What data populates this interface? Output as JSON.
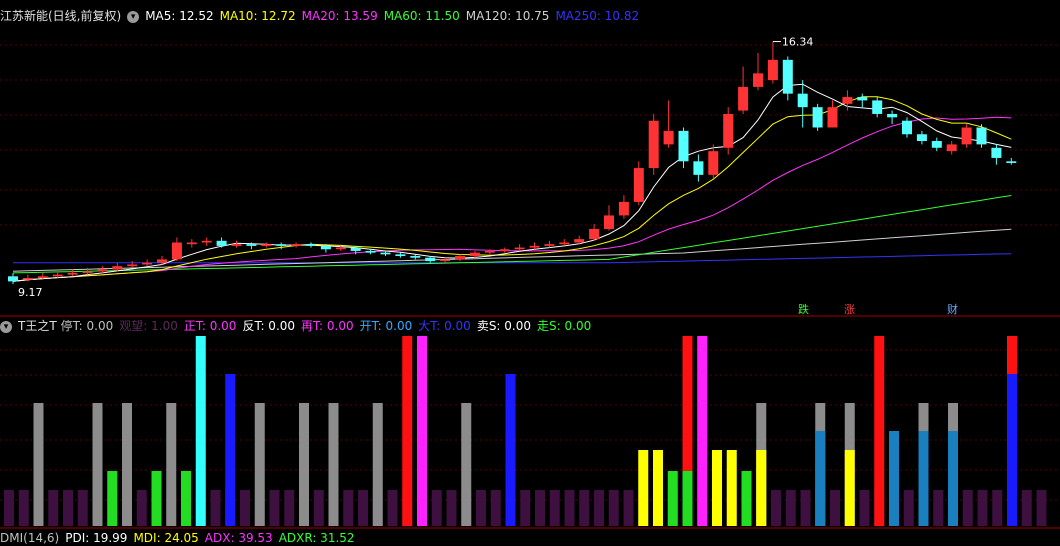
{
  "main": {
    "title": "江苏新能(日线,前复权)",
    "indicators": [
      {
        "label": "MA5: 12.52",
        "color": "#ffffff"
      },
      {
        "label": "MA10: 12.72",
        "color": "#ffff00"
      },
      {
        "label": "MA20: 13.59",
        "color": "#ff33ff"
      },
      {
        "label": "MA60: 11.50",
        "color": "#33ff33"
      },
      {
        "label": "MA120: 10.75",
        "color": "#d0d0d0"
      },
      {
        "label": "MA250: 10.82",
        "color": "#3333ff"
      }
    ],
    "price_high_label": "16.34",
    "price_low_label": "9.17",
    "signals": [
      {
        "label": "跌",
        "color": "#33ff33"
      },
      {
        "label": "涨",
        "color": "#ff4040"
      },
      {
        "label": "财",
        "color": "#66aaff"
      }
    ],
    "colors": {
      "up": "#ff3333",
      "down": "#54ffff",
      "grid": "#800000"
    }
  },
  "sub": {
    "title": "T王之T",
    "indicators": [
      {
        "label": "停T: 0.00",
        "color": "#c0c0c0"
      },
      {
        "label": "观望: 1.00",
        "color": "#5a2a5a"
      },
      {
        "label": "正T: 0.00",
        "color": "#ff33ff"
      },
      {
        "label": "反T: 0.00",
        "color": "#ffffff"
      },
      {
        "label": "再T: 0.00",
        "color": "#ff33ff"
      },
      {
        "label": "开T: 0.00",
        "color": "#33aaff"
      },
      {
        "label": "大T: 0.00",
        "color": "#3333ff"
      },
      {
        "label": "卖S: 0.00",
        "color": "#ffffff"
      },
      {
        "label": "走S: 0.00",
        "color": "#33ff33"
      }
    ]
  },
  "footer": {
    "items": [
      {
        "label": "DMI(14,6)",
        "color": "#c0c0c0"
      },
      {
        "label": "PDI: 19.99",
        "color": "#ffffff"
      },
      {
        "label": "MDI: 24.05",
        "color": "#ffff00"
      },
      {
        "label": "ADX: 39.53",
        "color": "#ff33ff"
      },
      {
        "label": "ADXR: 31.52",
        "color": "#33ff33"
      }
    ]
  },
  "chart_data": {
    "type": "candlestick",
    "candles": [
      [
        9.4,
        9.25,
        9.5,
        9.17
      ],
      [
        9.3,
        9.35,
        9.45,
        9.25
      ],
      [
        9.35,
        9.4,
        9.5,
        9.3
      ],
      [
        9.4,
        9.45,
        9.55,
        9.35
      ],
      [
        9.45,
        9.5,
        9.6,
        9.4
      ],
      [
        9.5,
        9.55,
        9.65,
        9.45
      ],
      [
        9.55,
        9.6,
        9.7,
        9.5
      ],
      [
        9.6,
        9.7,
        9.8,
        9.55
      ],
      [
        9.7,
        9.75,
        9.85,
        9.65
      ],
      [
        9.75,
        9.8,
        9.9,
        9.7
      ],
      [
        9.8,
        9.9,
        10.0,
        9.75
      ],
      [
        9.9,
        10.4,
        10.55,
        9.85
      ],
      [
        10.35,
        10.4,
        10.5,
        10.25
      ],
      [
        10.4,
        10.45,
        10.55,
        10.3
      ],
      [
        10.45,
        10.3,
        10.55,
        10.25
      ],
      [
        10.3,
        10.35,
        10.45,
        10.25
      ],
      [
        10.35,
        10.3,
        10.4,
        10.2
      ],
      [
        10.3,
        10.35,
        10.4,
        10.25
      ],
      [
        10.35,
        10.3,
        10.4,
        10.2
      ],
      [
        10.3,
        10.35,
        10.4,
        10.25
      ],
      [
        10.35,
        10.3,
        10.4,
        10.25
      ],
      [
        10.3,
        10.2,
        10.35,
        10.1
      ],
      [
        10.2,
        10.25,
        10.3,
        10.15
      ],
      [
        10.25,
        10.15,
        10.3,
        10.05
      ],
      [
        10.15,
        10.1,
        10.2,
        10.05
      ],
      [
        10.1,
        10.05,
        10.15,
        10.0
      ],
      [
        10.05,
        10.0,
        10.1,
        9.95
      ],
      [
        10.0,
        9.95,
        10.05,
        9.9
      ],
      [
        9.95,
        9.85,
        10.0,
        9.8
      ],
      [
        9.85,
        9.9,
        9.95,
        9.8
      ],
      [
        9.9,
        10.0,
        10.05,
        9.85
      ],
      [
        10.0,
        10.1,
        10.15,
        9.95
      ],
      [
        10.1,
        10.15,
        10.2,
        10.05
      ],
      [
        10.15,
        10.2,
        10.25,
        10.1
      ],
      [
        10.2,
        10.25,
        10.35,
        10.15
      ],
      [
        10.25,
        10.3,
        10.4,
        10.2
      ],
      [
        10.3,
        10.35,
        10.45,
        10.25
      ],
      [
        10.35,
        10.4,
        10.5,
        10.3
      ],
      [
        10.4,
        10.5,
        10.6,
        10.35
      ],
      [
        10.5,
        10.8,
        10.95,
        10.45
      ],
      [
        10.8,
        11.2,
        11.5,
        10.75
      ],
      [
        11.2,
        11.6,
        11.8,
        11.1
      ],
      [
        11.6,
        12.6,
        12.8,
        11.5
      ],
      [
        12.6,
        14.0,
        14.2,
        12.4
      ],
      [
        13.3,
        13.7,
        14.6,
        13.2
      ],
      [
        13.7,
        12.8,
        13.8,
        12.6
      ],
      [
        12.8,
        12.4,
        13.0,
        12.2
      ],
      [
        12.4,
        13.1,
        13.3,
        12.3
      ],
      [
        13.2,
        14.2,
        14.4,
        13.0
      ],
      [
        14.3,
        15.0,
        15.6,
        14.2
      ],
      [
        15.0,
        15.4,
        16.0,
        14.9
      ],
      [
        15.2,
        15.8,
        16.34,
        15.1
      ],
      [
        15.8,
        14.8,
        15.9,
        14.6
      ],
      [
        14.8,
        14.4,
        15.2,
        13.8
      ],
      [
        14.4,
        13.8,
        14.5,
        13.7
      ],
      [
        13.8,
        14.4,
        14.6,
        13.8
      ],
      [
        14.5,
        14.7,
        14.9,
        14.3
      ],
      [
        14.7,
        14.6,
        14.8,
        14.4
      ],
      [
        14.6,
        14.2,
        14.7,
        14.1
      ],
      [
        14.2,
        14.1,
        14.3,
        13.9
      ],
      [
        14.0,
        13.6,
        14.1,
        13.5
      ],
      [
        13.6,
        13.4,
        13.7,
        13.3
      ],
      [
        13.4,
        13.2,
        13.5,
        13.1
      ],
      [
        13.1,
        13.3,
        13.4,
        13.0
      ],
      [
        13.3,
        13.8,
        13.9,
        13.2
      ],
      [
        13.8,
        13.3,
        13.9,
        13.2
      ],
      [
        13.2,
        12.9,
        13.3,
        12.7
      ],
      [
        12.8,
        12.75,
        12.9,
        12.7
      ]
    ]
  }
}
